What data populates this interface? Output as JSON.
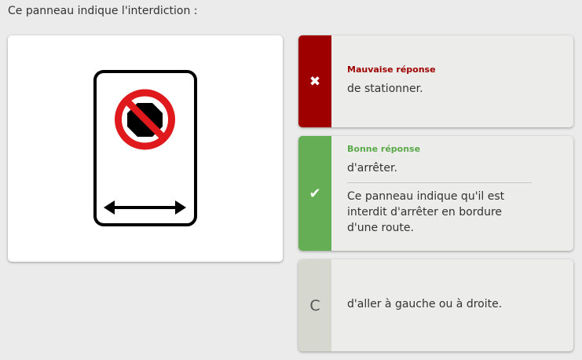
{
  "question": {
    "text": "Ce panneau indique l'interdiction :"
  },
  "image": {
    "icon": "no-stopping-sign",
    "colors": {
      "border": "#000000",
      "circle": "#e0191d",
      "octagon": "#000000"
    }
  },
  "answers": [
    {
      "marker_icon": "cross-icon",
      "marker": "✖",
      "status": "Mauvaise réponse",
      "text": "de stationner.",
      "color": "#9e0000"
    },
    {
      "marker_icon": "check-icon",
      "marker": "✔",
      "status": "Bonne réponse",
      "text": "d'arrêter.",
      "explanation": "Ce panneau indique qu'il est interdit d'arrêter en bordure d'une route.",
      "color": "#65ae56"
    },
    {
      "marker": "C",
      "text": "d'aller à gauche ou à droite.",
      "color": "#d6d8cf"
    }
  ]
}
